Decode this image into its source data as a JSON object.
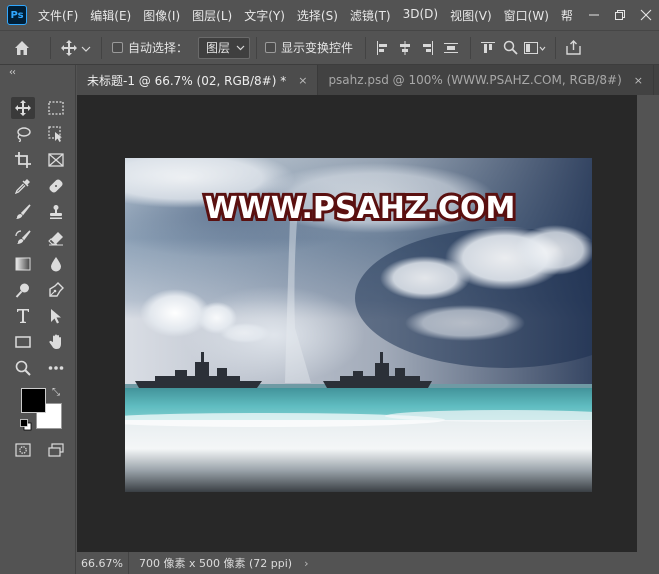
{
  "app": {
    "logo_text": "Ps"
  },
  "menu": [
    "文件(F)",
    "编辑(E)",
    "图像(I)",
    "图层(L)",
    "文字(Y)",
    "选择(S)",
    "滤镜(T)",
    "3D(D)",
    "视图(V)",
    "窗口(W)",
    "帮"
  ],
  "options": {
    "auto_select_label": "自动选择：",
    "layer_select_value": "图层",
    "show_transform_label": "显示变换控件"
  },
  "tabs": [
    {
      "label": "未标题-1 @ 66.7% (02, RGB/8#) *",
      "close": "×"
    },
    {
      "label": "psahz.psd @ 100% (WWW.PSAHZ.COM, RGB/8#)",
      "close": "×"
    }
  ],
  "canvas": {
    "watermark_text": "WWW.PSAHZ.COM"
  },
  "status": {
    "zoom": "66.67%",
    "doc_info": "700 像素 x 500 像素 (72 ppi)",
    "arrow": "›"
  },
  "colors": {
    "foreground": "#000000",
    "background": "#ffffff",
    "ui_bg": "#535353",
    "workspace_bg": "#282828"
  }
}
